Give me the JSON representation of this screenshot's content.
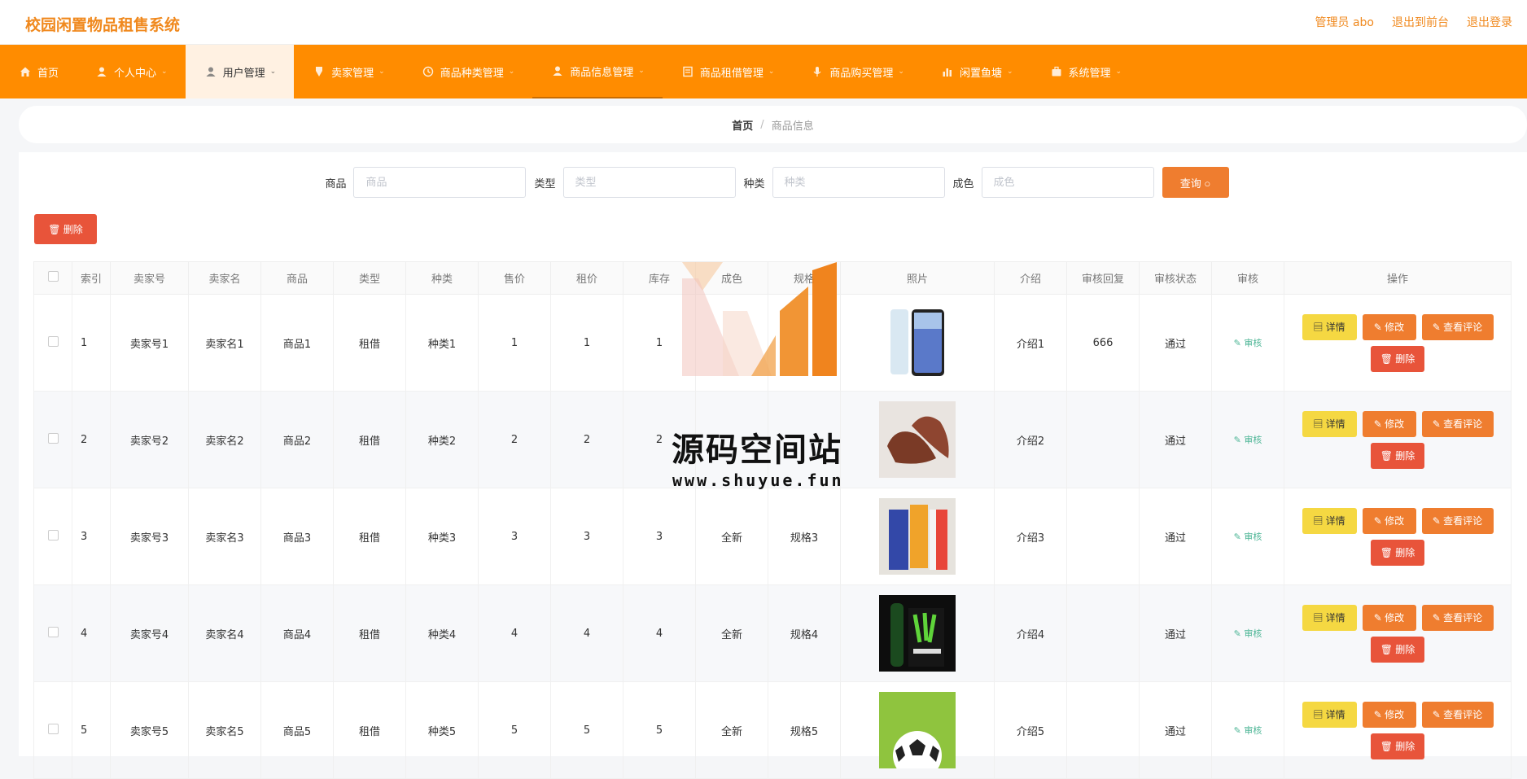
{
  "header": {
    "title": "校园闲置物品租售系统",
    "admin_label": "管理员 abo",
    "to_front": "退出到前台",
    "logout": "退出登录"
  },
  "nav": [
    {
      "label": "首页",
      "icon": "home-icon"
    },
    {
      "label": "个人中心",
      "icon": "user-icon"
    },
    {
      "label": "用户管理",
      "icon": "user-icon"
    },
    {
      "label": "卖家管理",
      "icon": "shield-icon"
    },
    {
      "label": "商品种类管理",
      "icon": "clock-icon"
    },
    {
      "label": "商品信息管理",
      "icon": "user-icon"
    },
    {
      "label": "商品租借管理",
      "icon": "doc-icon"
    },
    {
      "label": "商品购买管理",
      "icon": "mic-icon"
    },
    {
      "label": "闲置鱼塘",
      "icon": "bar-chart-icon"
    },
    {
      "label": "系统管理",
      "icon": "briefcase-icon"
    }
  ],
  "breadcrumb": {
    "home": "首页",
    "current": "商品信息"
  },
  "search": {
    "fields": [
      {
        "label": "商品",
        "placeholder": "商品"
      },
      {
        "label": "类型",
        "placeholder": "类型"
      },
      {
        "label": "种类",
        "placeholder": "种类"
      },
      {
        "label": "成色",
        "placeholder": "成色"
      }
    ],
    "query_button": "查询 ○"
  },
  "delete_button": "🗑 删除",
  "table": {
    "headers": [
      "索引",
      "卖家号",
      "卖家名",
      "商品",
      "类型",
      "种类",
      "售价",
      "租价",
      "库存",
      "成色",
      "规格",
      "照片",
      "介绍",
      "审核回复",
      "审核状态",
      "审核",
      "操作"
    ],
    "rows": [
      [
        "1",
        "卖家号1",
        "卖家名1",
        "商品1",
        "租借",
        "种类1",
        "1",
        "1",
        "1",
        "",
        "",
        "",
        "介绍1",
        "666",
        "通过"
      ],
      [
        "2",
        "卖家号2",
        "卖家名2",
        "商品2",
        "租借",
        "种类2",
        "2",
        "2",
        "2",
        "",
        "",
        "",
        "介绍2",
        "",
        "通过"
      ],
      [
        "3",
        "卖家号3",
        "卖家名3",
        "商品3",
        "租借",
        "种类3",
        "3",
        "3",
        "3",
        "全新",
        "规格3",
        "",
        "介绍3",
        "",
        "通过"
      ],
      [
        "4",
        "卖家号4",
        "卖家名4",
        "商品4",
        "租借",
        "种类4",
        "4",
        "4",
        "4",
        "全新",
        "规格4",
        "",
        "介绍4",
        "",
        "通过"
      ],
      [
        "5",
        "卖家号5",
        "卖家名5",
        "商品5",
        "租借",
        "种类5",
        "5",
        "5",
        "5",
        "全新",
        "规格5",
        "",
        "介绍5",
        "",
        "通过"
      ]
    ],
    "audit_label": "✎ 审核",
    "actions": {
      "detail": "▤ 详情",
      "edit": "✎ 修改",
      "comment": "✎ 查看评论",
      "delete": "🗑 删除"
    }
  },
  "watermark": {
    "text": "源码空间站",
    "url": "www.shuyue.fun"
  },
  "colors": {
    "accent": "#ff8c00",
    "brand": "#f0891e",
    "danger": "#e8543a",
    "warn": "#f5d842"
  }
}
